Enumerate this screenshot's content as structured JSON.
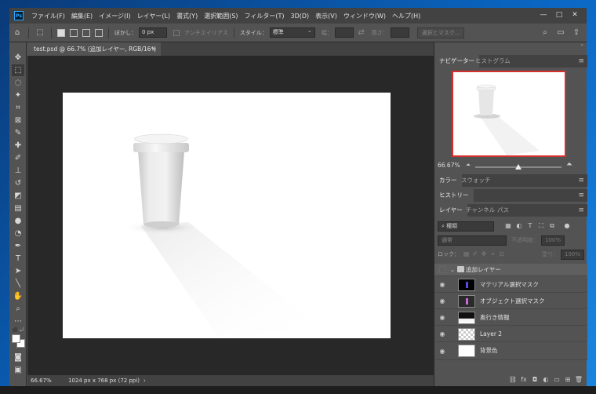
{
  "app": {
    "logo": "Ps"
  },
  "menu": [
    "ファイル(F)",
    "編集(E)",
    "イメージ(I)",
    "レイヤー(L)",
    "書式(Y)",
    "選択範囲(S)",
    "フィルター(T)",
    "3D(D)",
    "表示(V)",
    "ウィンドウ(W)",
    "ヘルプ(H)"
  ],
  "window_controls": {
    "minimize": "—",
    "maximize": "□",
    "close": "✕"
  },
  "options": {
    "feather_label": "ぼかし：",
    "feather_value": "0 px",
    "antialias_label": "アンチエイリアス",
    "style_label": "スタイル：",
    "style_value": "標準",
    "width_label": "幅：",
    "height_label": "高さ：",
    "select_mask_button": "選択とマスク..."
  },
  "document": {
    "tab_title": "test.psd @ 66.7% (追加レイヤー, RGB/16*)",
    "close": "×",
    "zoom": "66.67%",
    "dimensions": "1024 px x 768 px (72 ppi)",
    "arrow": "›"
  },
  "navigator": {
    "tabs": [
      "ナビゲーター",
      "ヒストグラム"
    ],
    "zoom": "66.67%",
    "slider_fraction": 0.5
  },
  "color_panel": {
    "tabs": [
      "カラー",
      "スウォッチ"
    ]
  },
  "history_panel": {
    "tabs": [
      "ヒストリー"
    ]
  },
  "layers_panel": {
    "tabs": [
      "レイヤー",
      "チャンネル",
      "パス"
    ],
    "filter_value": "種類",
    "blend_mode": "通常",
    "opacity_label": "不透明度：",
    "opacity_value": "100%",
    "lock_label": "ロック：",
    "fill_label": "塗り：",
    "fill_value": "100%",
    "layers": [
      {
        "name": "追加レイヤー",
        "kind": "group"
      },
      {
        "name": "マテリアル選択マスク",
        "kind": "black"
      },
      {
        "name": "オブジェクト選択マスク",
        "kind": "black"
      },
      {
        "name": "奥行き情報",
        "kind": "grad"
      },
      {
        "name": "Layer 2",
        "kind": "checker"
      },
      {
        "name": "背景色",
        "kind": "white"
      }
    ]
  },
  "colors": {
    "accent_red": "#d43030",
    "panel": "#535353",
    "canvas": "#282828"
  }
}
